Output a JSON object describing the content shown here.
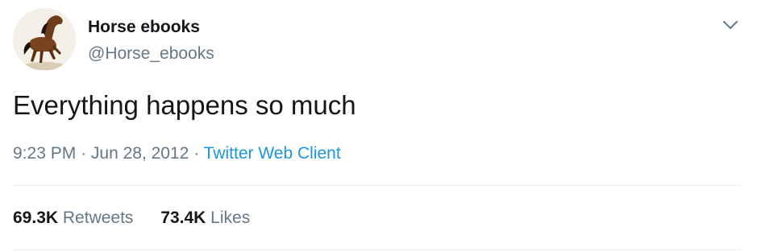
{
  "tweet": {
    "author": {
      "display_name": "Horse ebooks",
      "handle": "@Horse_ebooks",
      "avatar_icon": "horse-avatar-icon"
    },
    "menu_icon": "chevron-down-icon",
    "text": "Everything happens so much",
    "time": "9:23 PM",
    "separator": "·",
    "date": "Jun 28, 2012",
    "source": "Twitter Web Client",
    "stats": {
      "retweets_count": "69.3K",
      "retweets_label": "Retweets",
      "likes_count": "73.4K",
      "likes_label": "Likes"
    }
  },
  "colors": {
    "text": "#14171a",
    "secondary": "#657786",
    "link": "#1b95e0",
    "divider": "#e6ecf0"
  }
}
